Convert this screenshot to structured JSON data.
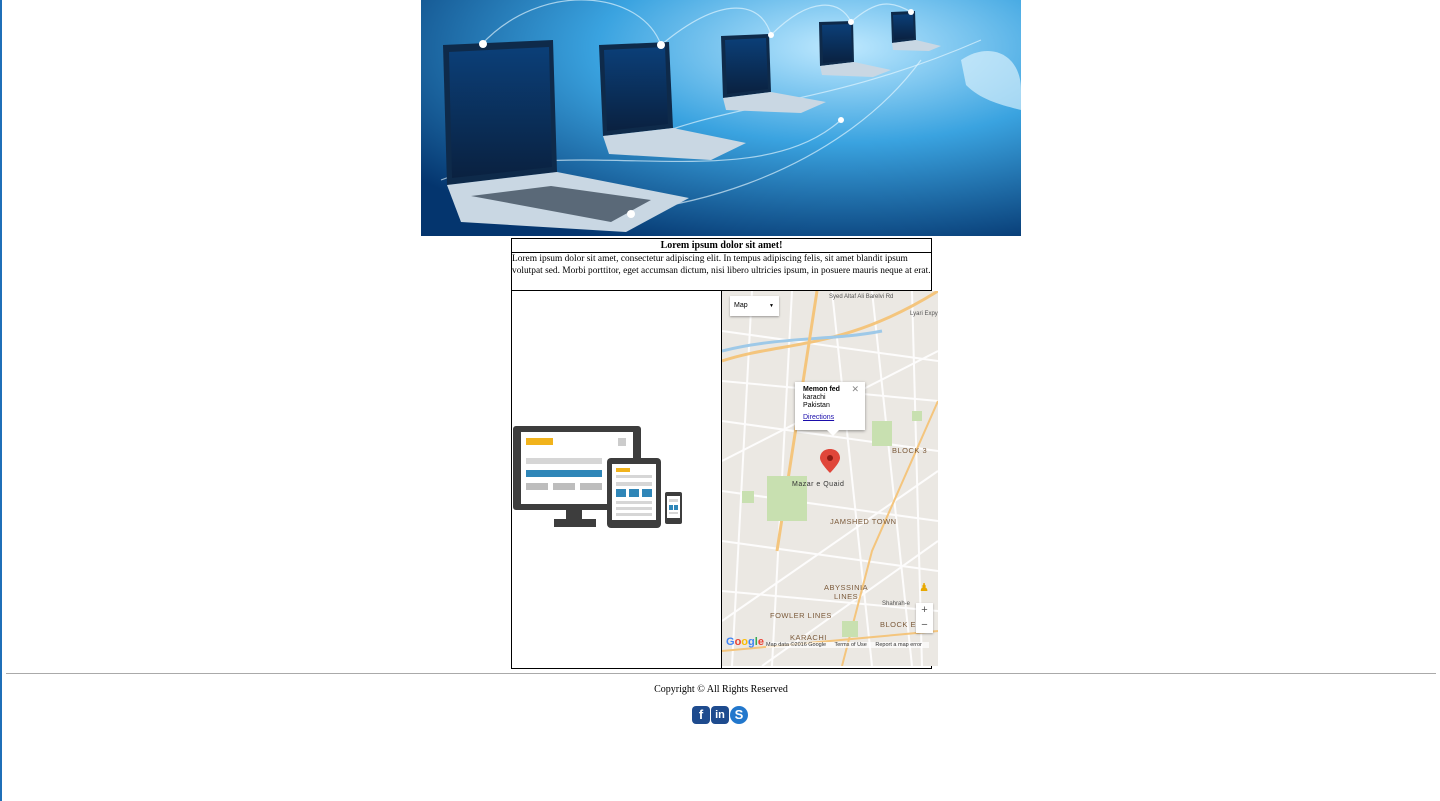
{
  "content_table": {
    "heading": "Lorem ipsum dolor sit amet!",
    "paragraph": "Lorem ipsum dolor sit amet, consectetur adipiscing elit. In tempus adipiscing felis, sit amet blandit ipsum volutpat sed. Morbi porttitor, eget accumsan dictum, nisi libero ultricies ipsum, in posuere mauris neque at erat."
  },
  "map": {
    "type_selector": "Map",
    "info_window": {
      "name": "Memon fed",
      "line1": "karachi",
      "line2": "Pakistan",
      "directions": "Directions"
    },
    "labels": {
      "block3": "BLOCK 3",
      "jamshed": "JAMSHED TOWN",
      "abyssinia1": "ABYSSINIA",
      "abyssinia2": "LINES",
      "fowler": "FOWLER LINES",
      "karachi": "KARACHI",
      "blockE": "BLOCK E",
      "shahrah": "Shahrah-e",
      "mazar": "Mazar e Quaid",
      "lyari": "Lyari Expy",
      "syed": "Syed Altaf Ali Barelvi Rd"
    },
    "zoom_in": "+",
    "zoom_out": "−",
    "google_logo": "Google",
    "attribution": [
      "Map data ©2016 Google",
      "Terms of Use",
      "Report a map error"
    ]
  },
  "footer": {
    "copyright": "Copyright © All Rights Reserved",
    "social": [
      "facebook",
      "linkedin",
      "skype"
    ]
  },
  "colors": {
    "accent_left_rule": "#1f6fb8",
    "social": "#1e4b8e"
  }
}
